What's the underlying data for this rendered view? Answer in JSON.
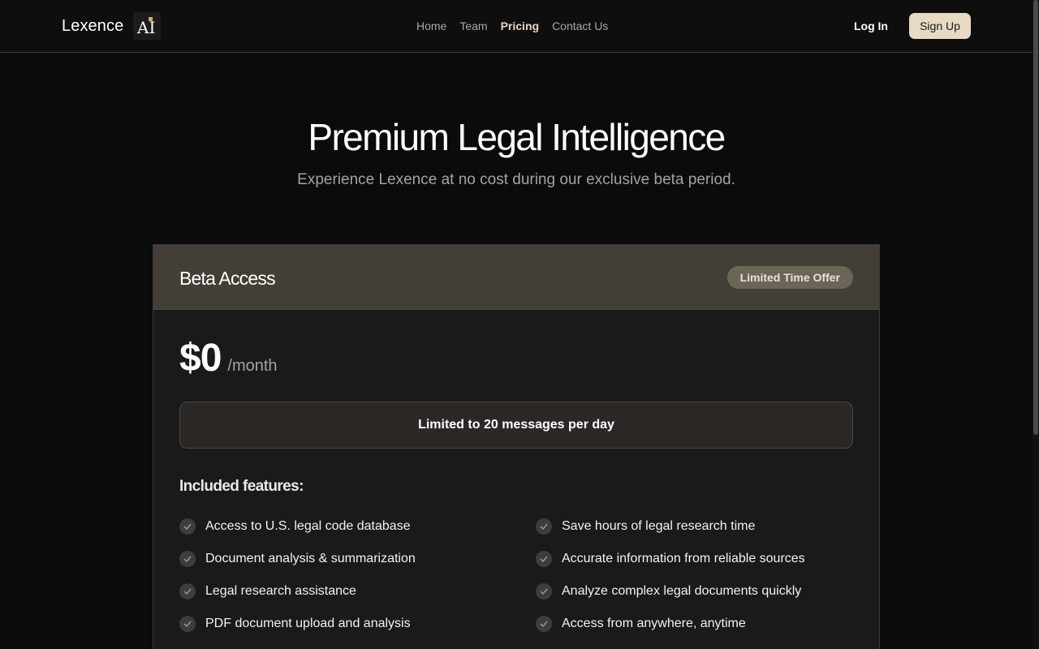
{
  "header": {
    "brand_name": "Lexence",
    "logo_text": "AI",
    "nav": [
      {
        "label": "Home",
        "active": false
      },
      {
        "label": "Team",
        "active": false
      },
      {
        "label": "Pricing",
        "active": true
      },
      {
        "label": "Contact Us",
        "active": false
      }
    ],
    "login_label": "Log In",
    "signup_label": "Sign Up"
  },
  "hero": {
    "title": "Premium Legal Intelligence",
    "subtitle": "Experience Lexence at no cost during our exclusive beta period."
  },
  "plan": {
    "name": "Beta Access",
    "badge": "Limited Time Offer",
    "price": "$0",
    "period": "/month",
    "limit": "Limited to 20 messages per day",
    "features_title": "Included features:",
    "features": [
      "Access to U.S. legal code database",
      "Save hours of legal research time",
      "Document analysis & summarization",
      "Accurate information from reliable sources",
      "Legal research assistance",
      "Analyze complex legal documents quickly",
      "PDF document upload and analysis",
      "Access from anywhere, anytime"
    ]
  },
  "colors": {
    "accent": "#e6dac4",
    "card_header": "#433f37",
    "badge": "#6a6557",
    "background": "#0b0b0b"
  },
  "icons": {
    "feature_check": "check-circle-icon",
    "logo": "ai-logo-icon"
  }
}
